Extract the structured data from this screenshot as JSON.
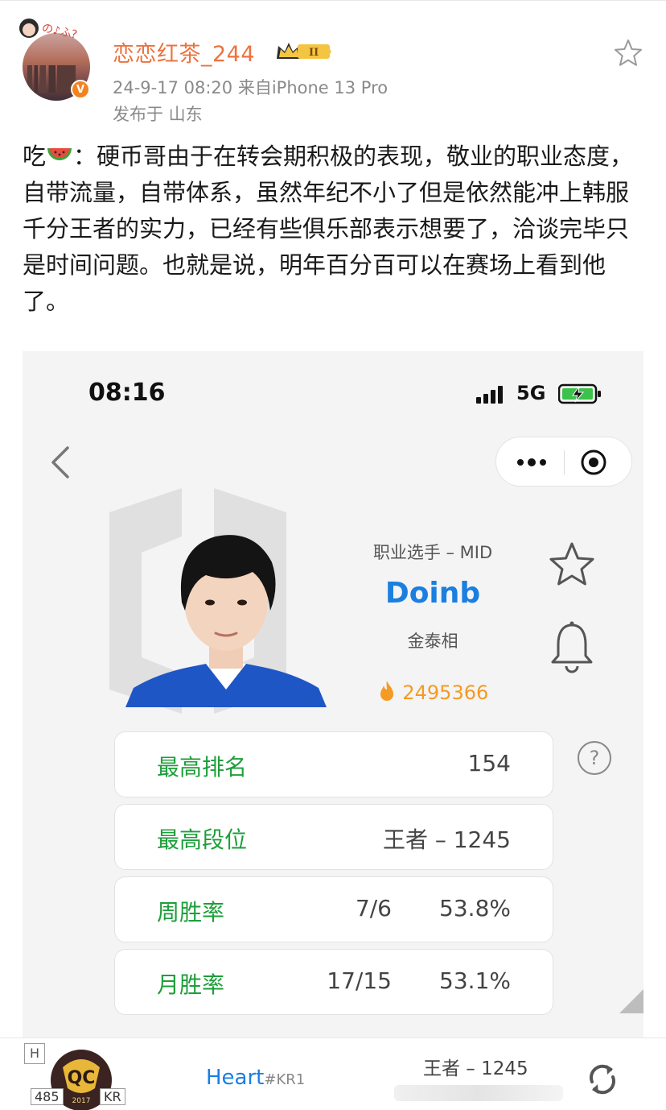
{
  "post": {
    "username": "恋恋红茶_244",
    "vip_level": "II",
    "meta": "24-9-17 08:20  来自iPhone 13 Pro",
    "location": "发布于 山东",
    "text_prefix": "吃",
    "text_body": "：硬币哥由于在转会期积极的表现，敬业的职业态度，自带流量，自带体系，虽然年纪不小了但是依然能冲上韩服千分王者的实力，已经有些俱乐部表示想要了，洽谈完毕只是时间问题。也就是说，明年百分百可以在赛场上看到他了。",
    "icons": {
      "favorite": "star-outline-icon",
      "verified": "verified-v-icon",
      "emoji": "watermelon-icon"
    },
    "colors": {
      "username": "#eb7340",
      "verified": "#f5821f"
    }
  },
  "screenshot": {
    "status_bar": {
      "time": "08:16",
      "network": "5G"
    },
    "player": {
      "role": "职业选手 – MID",
      "name": "Doinb",
      "real_name": "金泰相",
      "hot_count": "2495366"
    },
    "stats": [
      {
        "label": "最高排名",
        "mid": "",
        "value": "154"
      },
      {
        "label": "最高段位",
        "mid": "",
        "value": "王者 – 1245"
      },
      {
        "label": "周胜率",
        "mid": "7/6",
        "value": "53.8%"
      },
      {
        "label": "月胜率",
        "mid": "17/15",
        "value": "53.1%"
      }
    ],
    "colors": {
      "name": "#1a7fe0",
      "stat_label": "#1e9e3a",
      "hot": "#f59a23"
    }
  },
  "bottom": {
    "h_tag": "H",
    "team_number": "485",
    "region_tag": "KR",
    "player_name": "Heart",
    "player_tag": "#KR1",
    "rank": "王者 – 1245"
  }
}
